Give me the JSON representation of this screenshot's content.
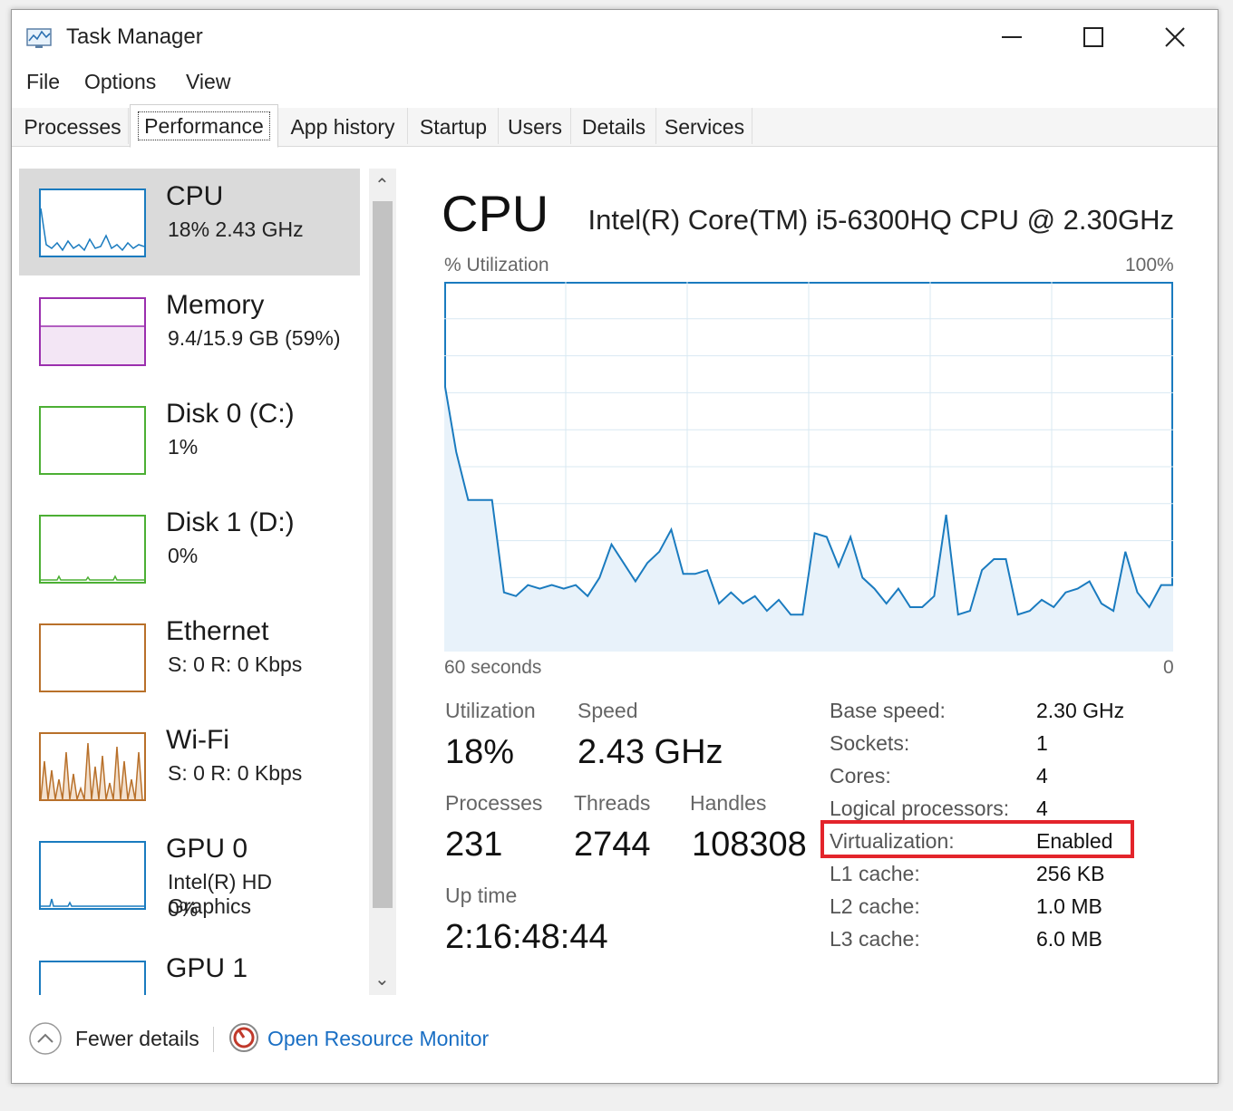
{
  "window": {
    "title": "Task Manager"
  },
  "menu": [
    "File",
    "Options",
    "View"
  ],
  "tabs": [
    "Processes",
    "Performance",
    "App history",
    "Startup",
    "Users",
    "Details",
    "Services"
  ],
  "active_tab": "Performance",
  "sidebar": {
    "items": [
      {
        "name": "CPU",
        "sub": "18%  2.43 GHz",
        "sub2": "",
        "color": "#1a7bbf"
      },
      {
        "name": "Memory",
        "sub": "9.4/15.9 GB (59%)",
        "sub2": "",
        "color": "#9b2fae"
      },
      {
        "name": "Disk 0 (C:)",
        "sub": "1%",
        "sub2": "",
        "color": "#4caf34"
      },
      {
        "name": "Disk 1 (D:)",
        "sub": "0%",
        "sub2": "",
        "color": "#4caf34"
      },
      {
        "name": "Ethernet",
        "sub": "S: 0  R: 0 Kbps",
        "sub2": "",
        "color": "#b8702a"
      },
      {
        "name": "Wi-Fi",
        "sub": "S: 0  R: 0 Kbps",
        "sub2": "",
        "color": "#b8702a"
      },
      {
        "name": "GPU 0",
        "sub": "Intel(R) HD Graphics",
        "sub2": "0%",
        "color": "#1a7bbf"
      },
      {
        "name": "GPU 1",
        "sub": "",
        "sub2": "",
        "color": "#1a7bbf"
      }
    ]
  },
  "main": {
    "title": "CPU",
    "cpu_model": "Intel(R) Core(TM) i5-6300HQ CPU @ 2.30GHz",
    "graph_top_left": "% Utilization",
    "graph_top_right": "100%",
    "graph_bottom_left": "60 seconds",
    "graph_bottom_right": "0",
    "stats": {
      "utilization_label": "Utilization",
      "utilization": "18%",
      "speed_label": "Speed",
      "speed": "2.43 GHz",
      "processes_label": "Processes",
      "processes": "231",
      "threads_label": "Threads",
      "threads": "2744",
      "handles_label": "Handles",
      "handles": "108308",
      "uptime_label": "Up time",
      "uptime": "2:16:48:44"
    },
    "specs": [
      {
        "label": "Base speed:",
        "value": "2.30 GHz"
      },
      {
        "label": "Sockets:",
        "value": "1"
      },
      {
        "label": "Cores:",
        "value": "4"
      },
      {
        "label": "Logical processors:",
        "value": "4"
      },
      {
        "label": "Virtualization:",
        "value": "Enabled"
      },
      {
        "label": "L1 cache:",
        "value": "256 KB"
      },
      {
        "label": "L2 cache:",
        "value": "1.0 MB"
      },
      {
        "label": "L3 cache:",
        "value": "6.0 MB"
      }
    ]
  },
  "cpu_history": [
    73,
    54,
    41,
    41,
    41,
    16,
    15,
    18,
    17,
    18,
    17,
    18,
    15,
    20,
    29,
    24,
    19,
    24,
    27,
    33,
    21,
    21,
    22,
    13,
    16,
    13,
    15,
    11,
    14,
    10,
    10,
    32,
    31,
    23,
    31,
    20,
    17,
    13,
    17,
    12,
    12,
    15,
    37,
    10,
    11,
    22,
    25,
    25,
    10,
    11,
    14,
    12,
    16,
    17,
    19,
    13,
    11,
    27,
    16,
    12,
    18,
    18
  ],
  "footer": {
    "fewer": "Fewer details",
    "monitor": "Open Resource Monitor"
  },
  "colors": {
    "cpu": "#1a7bbf",
    "highlight": "#e3242b",
    "link": "#1a6fc4"
  }
}
